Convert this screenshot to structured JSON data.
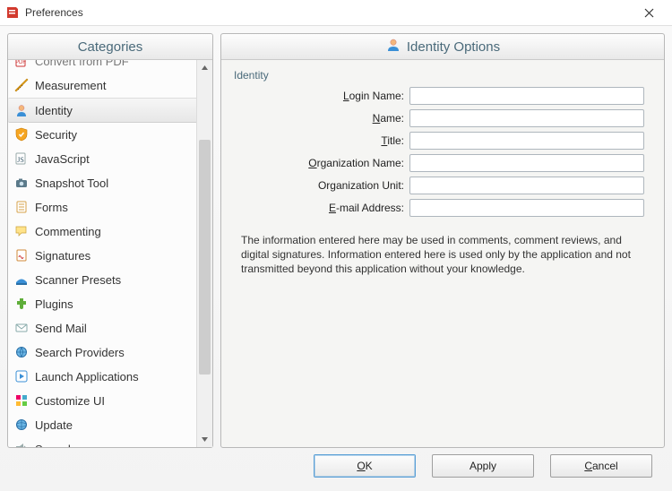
{
  "window": {
    "title": "Preferences"
  },
  "left": {
    "header": "Categories",
    "items": [
      {
        "label": "Convert from PDF",
        "icon": "convert-pdf-icon",
        "partial": "top"
      },
      {
        "label": "Measurement",
        "icon": "measurement-icon"
      },
      {
        "label": "Identity",
        "icon": "identity-icon",
        "selected": true
      },
      {
        "label": "Security",
        "icon": "security-icon"
      },
      {
        "label": "JavaScript",
        "icon": "javascript-icon"
      },
      {
        "label": "Snapshot Tool",
        "icon": "snapshot-icon"
      },
      {
        "label": "Forms",
        "icon": "forms-icon"
      },
      {
        "label": "Commenting",
        "icon": "commenting-icon"
      },
      {
        "label": "Signatures",
        "icon": "signatures-icon"
      },
      {
        "label": "Scanner Presets",
        "icon": "scanner-icon"
      },
      {
        "label": "Plugins",
        "icon": "plugins-icon"
      },
      {
        "label": "Send Mail",
        "icon": "sendmail-icon"
      },
      {
        "label": "Search Providers",
        "icon": "search-providers-icon"
      },
      {
        "label": "Launch Applications",
        "icon": "launch-apps-icon"
      },
      {
        "label": "Customize UI",
        "icon": "customize-ui-icon"
      },
      {
        "label": "Update",
        "icon": "update-icon"
      },
      {
        "label": "Speech",
        "icon": "speech-icon",
        "partial": "bottom"
      }
    ]
  },
  "right": {
    "header": "Identity Options",
    "group_title": "Identity",
    "fields": [
      {
        "key": "login_name",
        "label_pre": "",
        "mnemonic": "L",
        "label_post": "ogin Name:",
        "value": ""
      },
      {
        "key": "name",
        "label_pre": "",
        "mnemonic": "N",
        "label_post": "ame:",
        "value": ""
      },
      {
        "key": "title",
        "label_pre": "",
        "mnemonic": "T",
        "label_post": "itle:",
        "value": ""
      },
      {
        "key": "org_name",
        "label_pre": "",
        "mnemonic": "O",
        "label_post": "rganization Name:",
        "value": ""
      },
      {
        "key": "org_unit",
        "label_pre": "Organization Unit:",
        "mnemonic": "",
        "label_post": "",
        "value": ""
      },
      {
        "key": "email",
        "label_pre": "",
        "mnemonic": "E",
        "label_post": "-mail Address:",
        "value": ""
      }
    ],
    "info": "The information entered here may be used in comments, comment reviews, and digital signatures. Information entered here is used only by the application and not transmitted beyond this application without your knowledge."
  },
  "footer": {
    "ok": "OK",
    "apply": "Apply",
    "cancel": "Cancel"
  }
}
